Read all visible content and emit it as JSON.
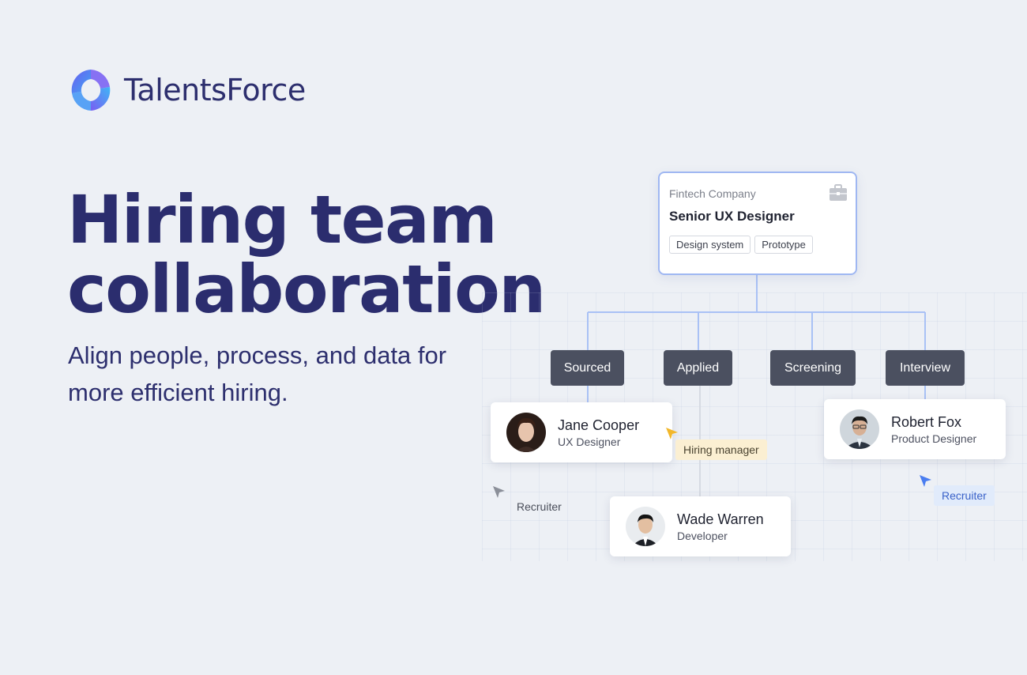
{
  "brand": {
    "name": "TalentsForce",
    "icon": "logo-ring-icon"
  },
  "hero": {
    "headline_line1": "Hiring team",
    "headline_line2": "collaboration",
    "subline_line1": "Align people, process, and data for",
    "subline_line2": "more efficient hiring."
  },
  "job": {
    "company": "Fintech Company",
    "title": "Senior UX Designer",
    "tags": [
      "Design system",
      "Prototype"
    ],
    "icon": "briefcase-icon"
  },
  "stages": [
    "Sourced",
    "Applied",
    "Screening",
    "Interview"
  ],
  "people": [
    {
      "name": "Jane Cooper",
      "role": "UX Designer"
    },
    {
      "name": "Wade Warren",
      "role": "Developer"
    },
    {
      "name": "Robert Fox",
      "role": "Product Designer"
    }
  ],
  "roles": {
    "hiring_manager": "Hiring manager",
    "recruiter_left": "Recruiter",
    "recruiter_right": "Recruiter"
  },
  "colors": {
    "headline": "#2b2d6e",
    "stage_bg": "#4b5060",
    "connector": "#a9c1f5",
    "hiring_manager_bg": "#fbefd2",
    "recruiter_bg": "#e1ebfb",
    "recruiter_text": "#3a62c9",
    "cursor_yellow": "#f2b72b",
    "cursor_blue": "#4a7df0",
    "cursor_gray": "#8b8f99"
  }
}
